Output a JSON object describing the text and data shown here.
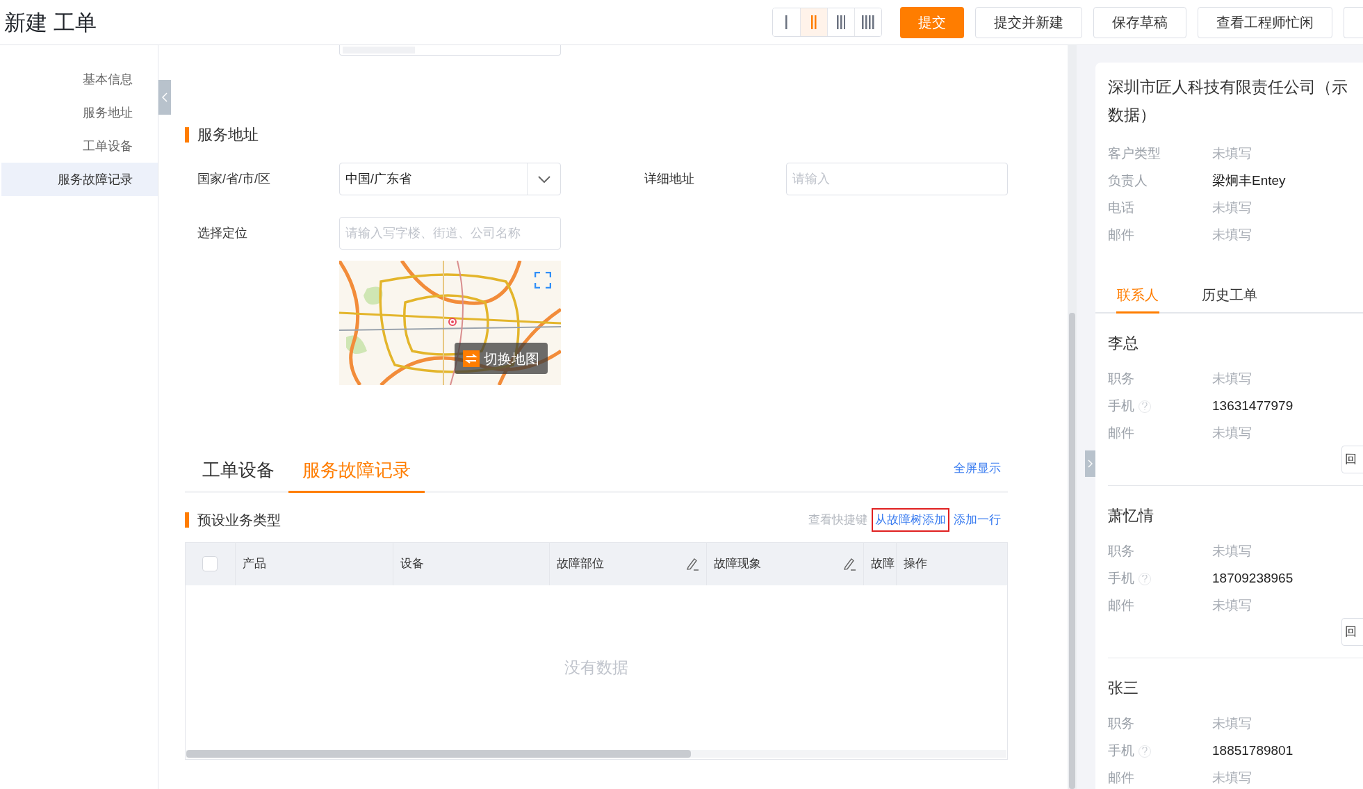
{
  "page_title": "新建 工单",
  "layout_options": [
    {
      "selected": false
    },
    {
      "selected": true
    },
    {
      "selected": false
    },
    {
      "selected": false
    }
  ],
  "actions": [
    {
      "label": "提交",
      "kind": "primary"
    },
    {
      "label": "提交并新建",
      "kind": "default"
    },
    {
      "label": "保存草稿",
      "kind": "default"
    },
    {
      "label": "查看工程师忙闲",
      "kind": "default"
    }
  ],
  "sidebar": {
    "items": [
      {
        "label": "基本信息",
        "selected": false
      },
      {
        "label": "服务地址",
        "selected": false
      },
      {
        "label": "工单设备",
        "selected": false
      },
      {
        "label": "服务故障记录",
        "selected": true
      }
    ]
  },
  "service_address": {
    "heading": "服务地址",
    "rows": [
      [
        {
          "label": "国家/省/市/区",
          "kind": "select",
          "value": "中国/广东省"
        },
        {
          "label": "详细地址",
          "kind": "input",
          "placeholder": "请输入"
        }
      ],
      [
        {
          "label": "选择定位",
          "kind": "input",
          "placeholder": "请输入写字楼、街道、公司名称"
        }
      ]
    ],
    "map_button": "切换地图"
  },
  "tabs": [
    {
      "label": "工单设备",
      "selected": false
    },
    {
      "label": "服务故障记录",
      "selected": true
    }
  ],
  "fullscreen_link": "全屏显示",
  "fault_section": {
    "heading": "预设业务类型",
    "actions": [
      {
        "label": "查看快捷键",
        "kind": "muted"
      },
      {
        "label": "从故障树添加",
        "kind": "outlined"
      },
      {
        "label": "添加一行",
        "kind": "link"
      }
    ]
  },
  "table": {
    "columns": [
      {
        "label": "产品",
        "editable": false
      },
      {
        "label": "设备",
        "editable": false
      },
      {
        "label": "故障部位",
        "editable": true
      },
      {
        "label": "故障现象",
        "editable": true
      },
      {
        "label": "故障"
      },
      {
        "label": "操作",
        "editable": false
      }
    ],
    "select_all_checked": false,
    "empty_text": "没有数据"
  },
  "customer": {
    "title_lines": [
      "深圳市匠人科技有限责任公司（示",
      "数据）"
    ],
    "fields": [
      {
        "label": "客户类型",
        "value": "未填写",
        "filled": false
      },
      {
        "label": "负责人",
        "value": "梁炯丰Entey",
        "filled": true
      },
      {
        "label": "电话",
        "value": "未填写",
        "filled": false
      },
      {
        "label": "邮件",
        "value": "未填写",
        "filled": false
      }
    ]
  },
  "customer_tabs": [
    {
      "label": "联系人",
      "selected": true
    },
    {
      "label": "历史工单",
      "selected": false
    }
  ],
  "contacts": [
    {
      "name": "李总",
      "fields": [
        {
          "label": "职务",
          "value": "未填写",
          "filled": false,
          "help": false
        },
        {
          "label": "手机",
          "value": "13631477979",
          "filled": true,
          "help": true
        },
        {
          "label": "邮件",
          "value": "未填写",
          "filled": false,
          "help": false
        }
      ],
      "button": "回"
    },
    {
      "name": "萧忆情",
      "fields": [
        {
          "label": "职务",
          "value": "未填写",
          "filled": false,
          "help": false
        },
        {
          "label": "手机",
          "value": "18709238965",
          "filled": true,
          "help": true
        },
        {
          "label": "邮件",
          "value": "未填写",
          "filled": false,
          "help": false
        }
      ],
      "button": "回"
    },
    {
      "name": "张三",
      "fields": [
        {
          "label": "职务",
          "value": "未填写",
          "filled": false,
          "help": false
        },
        {
          "label": "手机",
          "value": "18851789801",
          "filled": true,
          "help": true
        },
        {
          "label": "邮件",
          "value": "未填写",
          "filled": false,
          "help": false
        }
      ]
    }
  ]
}
